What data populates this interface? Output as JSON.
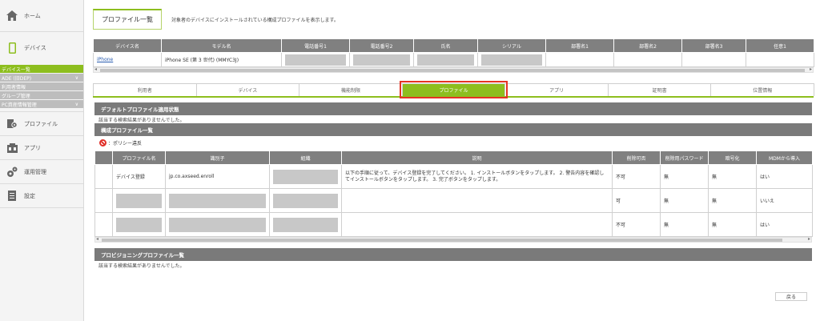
{
  "sidebar": {
    "home": "ホーム",
    "device": "デバイス",
    "subitems": [
      {
        "label": "デバイス一覧",
        "chev": ""
      },
      {
        "label": "ADE (旧DEP)",
        "chev": "∨"
      },
      {
        "label": "利用者情報",
        "chev": ""
      },
      {
        "label": "グループ管理",
        "chev": ""
      },
      {
        "label": "PC資産情報管理",
        "chev": "∨"
      }
    ],
    "profile": "プロファイル",
    "app": "アプリ",
    "ops": "運用管理",
    "settings": "設定"
  },
  "header": {
    "title": "プロファイル一覧",
    "description": "対象者のデバイスにインストールされている構成プロファイルを表示します。"
  },
  "device_table": {
    "columns": [
      "デバイス名",
      "モデル名",
      "電話番号1",
      "電話番号2",
      "氏名",
      "シリアル",
      "部署名1",
      "部署名2",
      "部署名3",
      "任意1"
    ],
    "row": {
      "device": "iPhone",
      "model": "iPhone SE (第 3 世代) (MMYC3J)"
    }
  },
  "tabs": [
    "利用者",
    "デバイス",
    "機能制限",
    "プロファイル",
    "アプリ",
    "証明書",
    "位置情報"
  ],
  "default_profile": {
    "header": "デフォルトプロファイル適用状態",
    "empty": "該当する検索結果がありませんでした。"
  },
  "config_profiles": {
    "header": "構成プロファイル一覧",
    "policy_label": "：ポリシー違反",
    "columns": [
      "",
      "プロファイル名",
      "識別子",
      "組織",
      "説明",
      "削除可否",
      "削除用パスワード",
      "暗号化",
      "MDMから導入"
    ],
    "rows": [
      {
        "name": "デバイス登録",
        "identifier": "jp.co.axseed.enroll",
        "description": "以下の手順に従って、デバイス登録を完了してください。 1. インストールボタンをタップします。 2. 警告内容を確認してインストールボタンをタップします。 3. 完了ボタンをタップします。",
        "deletable": "不可",
        "password": "無",
        "encrypted": "無",
        "from_mdm": "はい"
      },
      {
        "name": "",
        "identifier": "",
        "description": "",
        "deletable": "可",
        "password": "無",
        "encrypted": "無",
        "from_mdm": "いいえ"
      },
      {
        "name": "",
        "identifier": "",
        "description": "",
        "deletable": "不可",
        "password": "無",
        "encrypted": "無",
        "from_mdm": "はい"
      }
    ]
  },
  "provisioning": {
    "header": "プロビジョニングプロファイル一覧",
    "empty": "該当する検索結果がありませんでした。"
  },
  "back_button": "戻る",
  "colors": {
    "accent": "#8dbe1e",
    "highlight": "#e53323",
    "header_gray": "#7a7a7a"
  }
}
